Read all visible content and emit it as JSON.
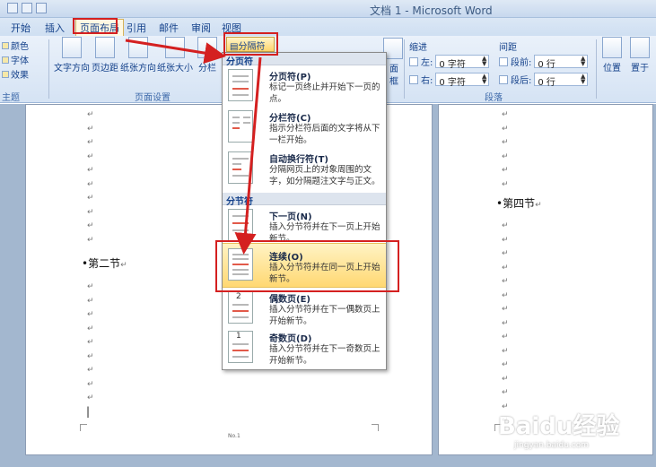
{
  "window": {
    "title": "文档 1 - Microsoft Word"
  },
  "tabs": [
    "开始",
    "插入",
    "页面布局",
    "引用",
    "邮件",
    "审阅",
    "视图"
  ],
  "ribbon": {
    "themes": [
      "颜色",
      "字体",
      "效果"
    ],
    "page_setup_buttons": [
      "文字方向",
      "页边距",
      "纸张方向",
      "纸张大小",
      "分栏"
    ],
    "group_themes": "主题",
    "group_page_setup": "页面设置",
    "breaks_label": "分隔符",
    "partial_labels": [
      "面",
      "框"
    ],
    "indent": {
      "title": "缩进",
      "left_label": "左:",
      "left_value": "0 字符",
      "right_label": "右:",
      "right_value": "0 字符"
    },
    "spacing": {
      "title": "间距",
      "before_label": "段前:",
      "before_value": "0 行",
      "after_label": "段后:",
      "after_value": "0 行"
    },
    "group_paragraph": "段落",
    "arrange_buttons": [
      "位置",
      "置于"
    ]
  },
  "menu": {
    "section_page": "分页符",
    "section_section": "分节符",
    "items": [
      {
        "title": "分页符(P)",
        "desc": "标记一页终止并开始下一页的点。"
      },
      {
        "title": "分栏符(C)",
        "desc": "指示分栏符后面的文字将从下一栏开始。"
      },
      {
        "title": "自动换行符(T)",
        "desc": "分隔网页上的对象周围的文字，如分隔题注文字与正文。"
      },
      {
        "title": "下一页(N)",
        "desc": "插入分节符并在下一页上开始新节。"
      },
      {
        "title": "连续(O)",
        "desc": "插入分节符并在同一页上开始新节。"
      },
      {
        "title": "偶数页(E)",
        "desc": "插入分节符并在下一偶数页上开始新节。"
      },
      {
        "title": "奇数页(D)",
        "desc": "插入分节符并在下一奇数页上开始新节。"
      }
    ],
    "icon_numbers": [
      "2",
      "1"
    ]
  },
  "document": {
    "heading_left": "第二节",
    "heading_right": "第四节",
    "para_mark": "↵",
    "footer_text": "No.1"
  },
  "watermark": {
    "brand": "Baidu经验",
    "url": "jingyan.baidu.com"
  },
  "colors": {
    "highlight": "#ffd872",
    "annotation": "#d42020"
  }
}
